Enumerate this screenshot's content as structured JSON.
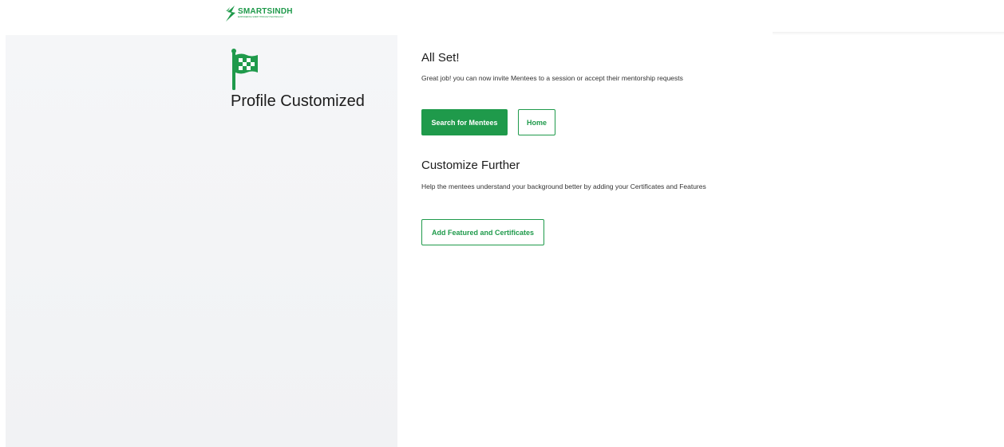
{
  "brand": {
    "name": "SMARTSINDH",
    "tagline": "EMPOWERING SINDH THROUGH TECHNOLOGY",
    "logo_icon": "smartsindh-logo-icon",
    "accent_color": "#1f9a4b"
  },
  "left_panel": {
    "icon": "checkered-flag-icon",
    "title": "Profile Customized"
  },
  "all_set": {
    "heading": "All Set!",
    "description": "Great job! you can now invite Mentees to a session or accept their mentorship requests",
    "primary_button_label": "Search for Mentees",
    "secondary_button_label": "Home"
  },
  "customize_further": {
    "heading": "Customize Further",
    "description": "Help the mentees understand your background better by adding your Certificates and Features",
    "button_label": "Add Featured and Certificates"
  }
}
